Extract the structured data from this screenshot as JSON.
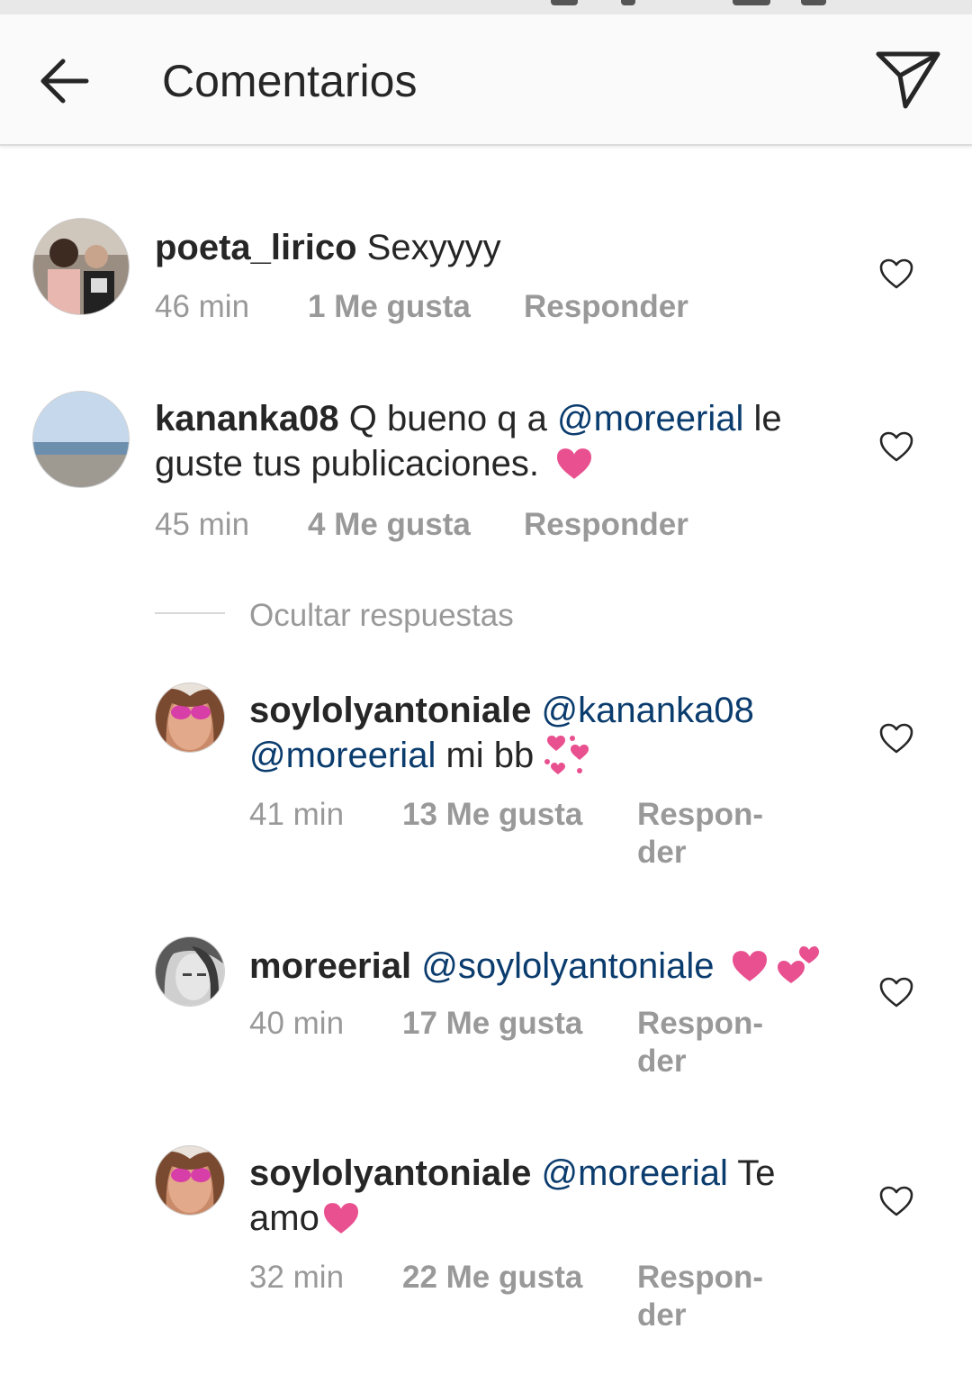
{
  "header": {
    "title": "Comentarios"
  },
  "comments": [
    {
      "username": "poeta_lirico",
      "text": "Sexyyyy",
      "time": "46 min",
      "likes": "1 Me gusta",
      "reply": "Responder"
    },
    {
      "username": "kananka08",
      "text": "Q bueno q a ",
      "mention": "@moreerial",
      "text_after": " le guste tus publicaciones.",
      "time": "45 min",
      "likes": "4 Me gusta",
      "reply": "Responder"
    }
  ],
  "replies_toggle": "Ocultar respuestas",
  "replies": [
    {
      "username": "soylolyantoniale",
      "mention1": "@kananka08",
      "mention2": "@moreerial",
      "text": " mi bb",
      "time": "41 min",
      "likes": "13 Me gusta",
      "reply_line1": "Respon-",
      "reply_line2": "der"
    },
    {
      "username": "moreerial",
      "mention": "@soylolyantoniale",
      "time": "40 min",
      "likes": "17 Me gusta",
      "reply_line1": "Respon-",
      "reply_line2": "der"
    },
    {
      "username": "soylolyantoniale",
      "mention": "@moreerial",
      "text": " Te amo",
      "time": "32 min",
      "likes": "22 Me gusta",
      "reply_line1": "Respon-",
      "reply_line2": "der"
    }
  ],
  "colors": {
    "mention": "#0b3c6e",
    "meta": "#999999",
    "emoji_heart": "#e8508f"
  }
}
